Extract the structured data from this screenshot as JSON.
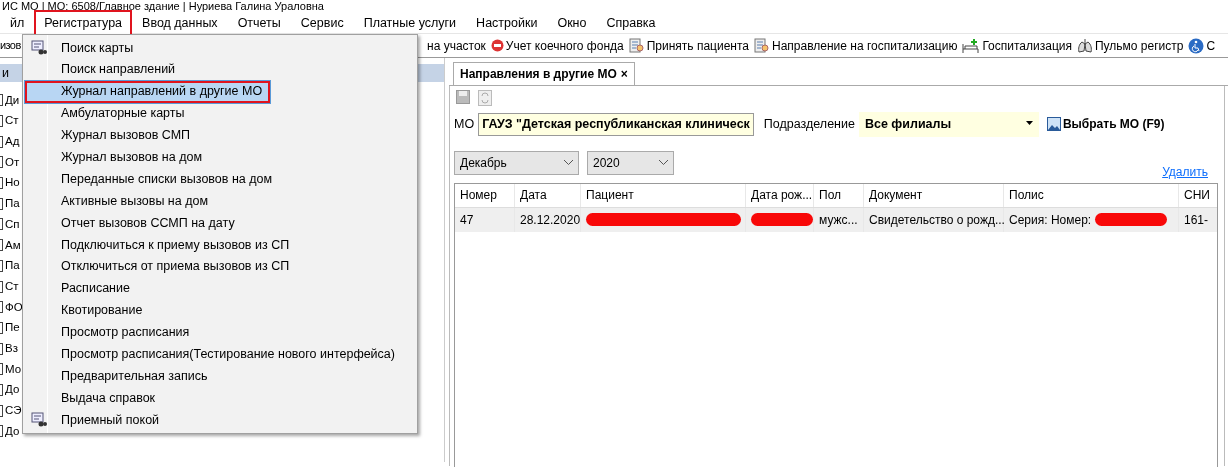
{
  "window": {
    "title": "ИС МО | МО: 6508/Главное здание | Нуриева Галина Ураловна"
  },
  "menu_bar": [
    {
      "label": "йл",
      "selected": false,
      "annotated": false
    },
    {
      "label": "Регистратура",
      "selected": true,
      "annotated": true
    },
    {
      "label": "Ввод данных",
      "selected": false,
      "annotated": false
    },
    {
      "label": "Отчеты",
      "selected": false,
      "annotated": false
    },
    {
      "label": "Сервис",
      "selected": false,
      "annotated": false
    },
    {
      "label": "Платные услуги",
      "selected": false,
      "annotated": false
    },
    {
      "label": "Настройки",
      "selected": false,
      "annotated": false
    },
    {
      "label": "Окно",
      "selected": false,
      "annotated": false
    },
    {
      "label": "Справка",
      "selected": false,
      "annotated": false
    }
  ],
  "toolbar": [
    {
      "label": "изов",
      "kind": "plain"
    },
    {
      "label": "на участок",
      "kind": "plain"
    },
    {
      "label": "Учет коечного фонда",
      "kind": "stop"
    },
    {
      "label": "Принять пациента",
      "kind": "doc"
    },
    {
      "label": "Направление на госпитализацию",
      "kind": "doc"
    },
    {
      "label": "Госпитализация",
      "kind": "bed"
    },
    {
      "label": "Пульмо регистр",
      "kind": "lungs"
    },
    {
      "label": "С",
      "kind": "wheelchair"
    }
  ],
  "left_panel": {
    "header": "и",
    "items": [
      "Ди",
      "Ст",
      "Ад",
      "От",
      "Но",
      "Па",
      "Сп",
      "Ам",
      "Па",
      "Ст",
      "ФО",
      "Пе",
      "Вз",
      "Мо",
      "До",
      "СЭ",
      "До"
    ]
  },
  "dropdown": [
    {
      "label": "Поиск карты",
      "icon": true,
      "selected": false,
      "annotated": false
    },
    {
      "label": "Поиск направлений",
      "icon": false,
      "selected": false,
      "annotated": false
    },
    {
      "label": "Журнал направлений в другие МО",
      "icon": false,
      "selected": true,
      "annotated": true
    },
    {
      "label": "Амбулаторные карты",
      "icon": false,
      "selected": false,
      "annotated": false
    },
    {
      "label": "Журнал вызовов СМП",
      "icon": false,
      "selected": false,
      "annotated": false
    },
    {
      "label": "Журнал вызовов на дом",
      "icon": false,
      "selected": false,
      "annotated": false
    },
    {
      "label": "Переданные списки вызовов на дом",
      "icon": false,
      "selected": false,
      "annotated": false
    },
    {
      "label": "Активные вызовы на дом",
      "icon": false,
      "selected": false,
      "annotated": false
    },
    {
      "label": "Отчет вызовов ССМП на дату",
      "icon": false,
      "selected": false,
      "annotated": false
    },
    {
      "label": "Подключиться к приему вызовов из СП",
      "icon": false,
      "selected": false,
      "annotated": false
    },
    {
      "label": "Отключиться от приема вызовов из СП",
      "icon": false,
      "selected": false,
      "annotated": false
    },
    {
      "label": "Расписание",
      "icon": false,
      "selected": false,
      "annotated": false
    },
    {
      "label": "Квотирование",
      "icon": false,
      "selected": false,
      "annotated": false
    },
    {
      "label": "Просмотр расписания",
      "icon": false,
      "selected": false,
      "annotated": false
    },
    {
      "label": "Просмотр расписания(Тестирование нового интерфейса)",
      "icon": false,
      "selected": false,
      "annotated": false
    },
    {
      "label": "Предварительная запись",
      "icon": false,
      "selected": false,
      "annotated": false
    },
    {
      "label": "Выдача справок",
      "icon": false,
      "selected": false,
      "annotated": false
    },
    {
      "label": "Приемный покой",
      "icon": true,
      "selected": false,
      "annotated": false
    }
  ],
  "document_tab": {
    "label": "Направления в другие МО",
    "close": "×"
  },
  "filters": {
    "mo_label": "МО",
    "mo_value": "ГАУЗ \"Детская республиканская клиническ",
    "division_label": "Подразделение",
    "division_value": "Все филиалы",
    "choose_button": "Выбрать МО (F9)",
    "month": "Декабрь",
    "year": "2020",
    "delete_link": "Удалить"
  },
  "table": {
    "columns": [
      "Номер",
      "Дата",
      "Пациент",
      "Дата рож...",
      "Пол",
      "Документ",
      "Полис",
      "СНИ"
    ],
    "rows": [
      {
        "cells": [
          {
            "text": "47",
            "redacted": false
          },
          {
            "text": "28.12.2020",
            "redacted": false
          },
          {
            "text": "",
            "redacted": true
          },
          {
            "text": "",
            "redacted": true
          },
          {
            "text": "мужс...",
            "redacted": false
          },
          {
            "text": "Свидетельство о рожд...",
            "redacted": false
          },
          {
            "text": "Серия:  Номер:",
            "redacted": true
          },
          {
            "text": "161-",
            "redacted": false
          }
        ]
      }
    ]
  }
}
